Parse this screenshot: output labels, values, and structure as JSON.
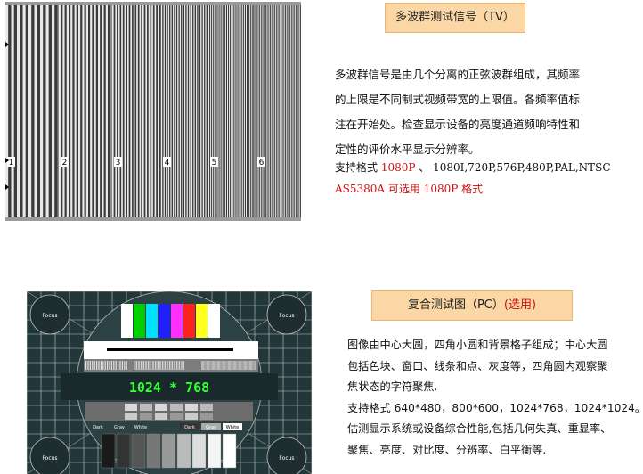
{
  "section1": {
    "caption": "多波群测试信号（TV）",
    "lines": [
      "多波群信号是由几个分离的正弦波群组成，其频率",
      "的上限是不同制式视频带宽的上限值。各频率值标",
      "注在开始处。检查显示设备的亮度通道频响特性和",
      "定性的评价水平显示分辨率。"
    ],
    "formats_prefix": "支持格式 ",
    "formats_highlight": "1080P",
    "formats_rest": " 、 1080I,720P,576P,480P,PAL,NTSC",
    "note_model": "AS5380A",
    "note_text": " 可选用 1080P 格式",
    "burst_labels": [
      "1",
      "2",
      "3",
      "4",
      "5",
      "6"
    ]
  },
  "section2": {
    "caption_main": "复合测试图（PC）",
    "caption_opt": "(选用)",
    "lines": [
      "图像由中心大圆，四角小圆和背景格子组成；中心大圆",
      "包括色块、窗口、线条和点、灰度等，四角圆内观察聚",
      "焦状态的字符聚焦."
    ],
    "formats_line": "支持格式  640*480，800*600，1024*768，1024*1024。",
    "eval_lines": [
      "估测显示系统或设备综合性能,包括几何失真、重显率、",
      "聚焦、亮度、对比度、分辨率、白平衡等."
    ],
    "card": {
      "resolution": "1024 * 768",
      "focus_label": "Focus",
      "gray_labels": [
        "Dark",
        "Gray",
        "White"
      ],
      "window_labels": [
        "Dark",
        "Gray",
        "White"
      ],
      "color_bars": [
        "#ffffff",
        "#00d000",
        "#00e0ff",
        "#2020ff",
        "#ff30ff",
        "#ff2020",
        "#ffff20",
        "#ffffff"
      ]
    }
  },
  "colors": {
    "caption_bg": "#fbd7a6",
    "highlight_red": "#d01010",
    "card_bg": "#243a3d",
    "resolution_green": "#33ff33"
  }
}
